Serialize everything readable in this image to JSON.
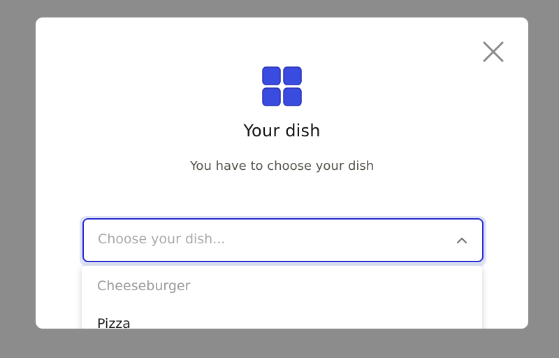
{
  "modal": {
    "title": "Your dish",
    "subtitle": "You have to choose your dish",
    "close_icon": "close-icon",
    "header_icon": "grid-four-squares-icon"
  },
  "select": {
    "placeholder": "Choose your dish...",
    "chevron_icon": "chevron-up-icon",
    "options": [
      {
        "label": "Cheeseburger",
        "state": "disabled"
      },
      {
        "label": "Pizza",
        "state": "enabled"
      }
    ]
  },
  "colors": {
    "backdrop": "#8c8c8c",
    "accent": "#3a4be0",
    "focus_ring": "#dfe3f7",
    "border": "#2a2fcf"
  }
}
